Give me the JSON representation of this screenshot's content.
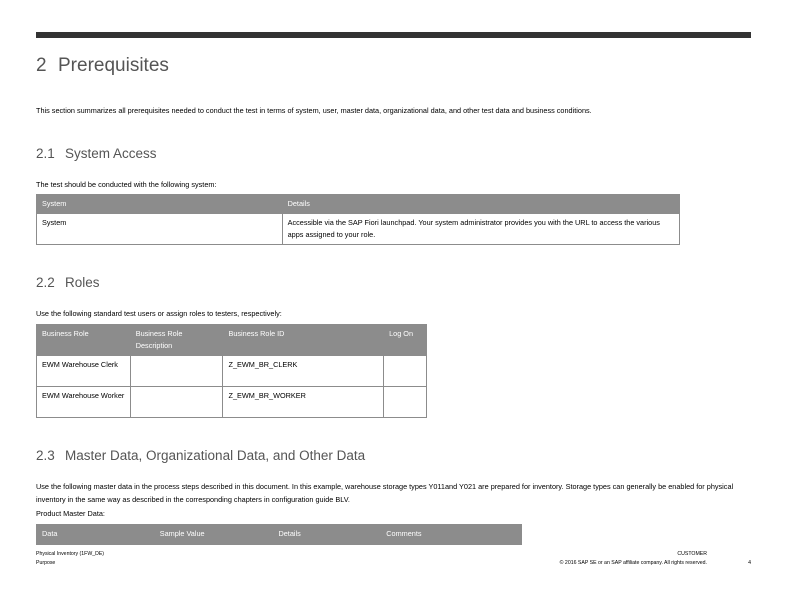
{
  "section": {
    "number": "2",
    "title": "Prerequisites"
  },
  "intro": "This section summarizes all prerequisites needed to conduct the test in terms of system, user, master data, organizational data, and other test data and business conditions.",
  "system_access": {
    "number": "2.1",
    "title": "System Access",
    "text": "The test should be conducted with the following system:",
    "headers": [
      "System",
      "Details"
    ],
    "rows": [
      [
        "System",
        "Accessible via the SAP Fiori launchpad. Your system administrator provides you with the URL to access the various apps assigned to your role."
      ]
    ]
  },
  "roles": {
    "number": "2.2",
    "title": "Roles",
    "text": "Use the following standard test users or assign roles to testers, respectively:",
    "headers": [
      "Business Role",
      "Business Role Description",
      "Business Role ID",
      "Log On"
    ],
    "rows": [
      [
        "EWM Warehouse Clerk",
        "",
        "Z_EWM_BR_CLERK",
        ""
      ],
      [
        "EWM Warehouse Worker",
        "",
        "Z_EWM_BR_WORKER",
        ""
      ]
    ]
  },
  "master_data": {
    "number": "2.3",
    "title": "Master Data, Organizational Data, and Other Data",
    "text": "Use the following master data in the process steps described in this document. In this example, warehouse storage types Y011and Y021 are prepared for inventory. Storage types can generally be enabled for physical inventory in the same way as described in the corresponding chapters in configuration guide BLV.",
    "product_label": "Product Master Data:",
    "headers": [
      "Data",
      "Sample Value",
      "Details",
      "Comments"
    ]
  },
  "footer": {
    "doc_title": "Physical Inventory (1FW_DE)",
    "section": "Purpose",
    "classification": "CUSTOMER",
    "copyright": "© 2016 SAP SE or an SAP affiliate company. All rights reserved.",
    "page": "4"
  }
}
